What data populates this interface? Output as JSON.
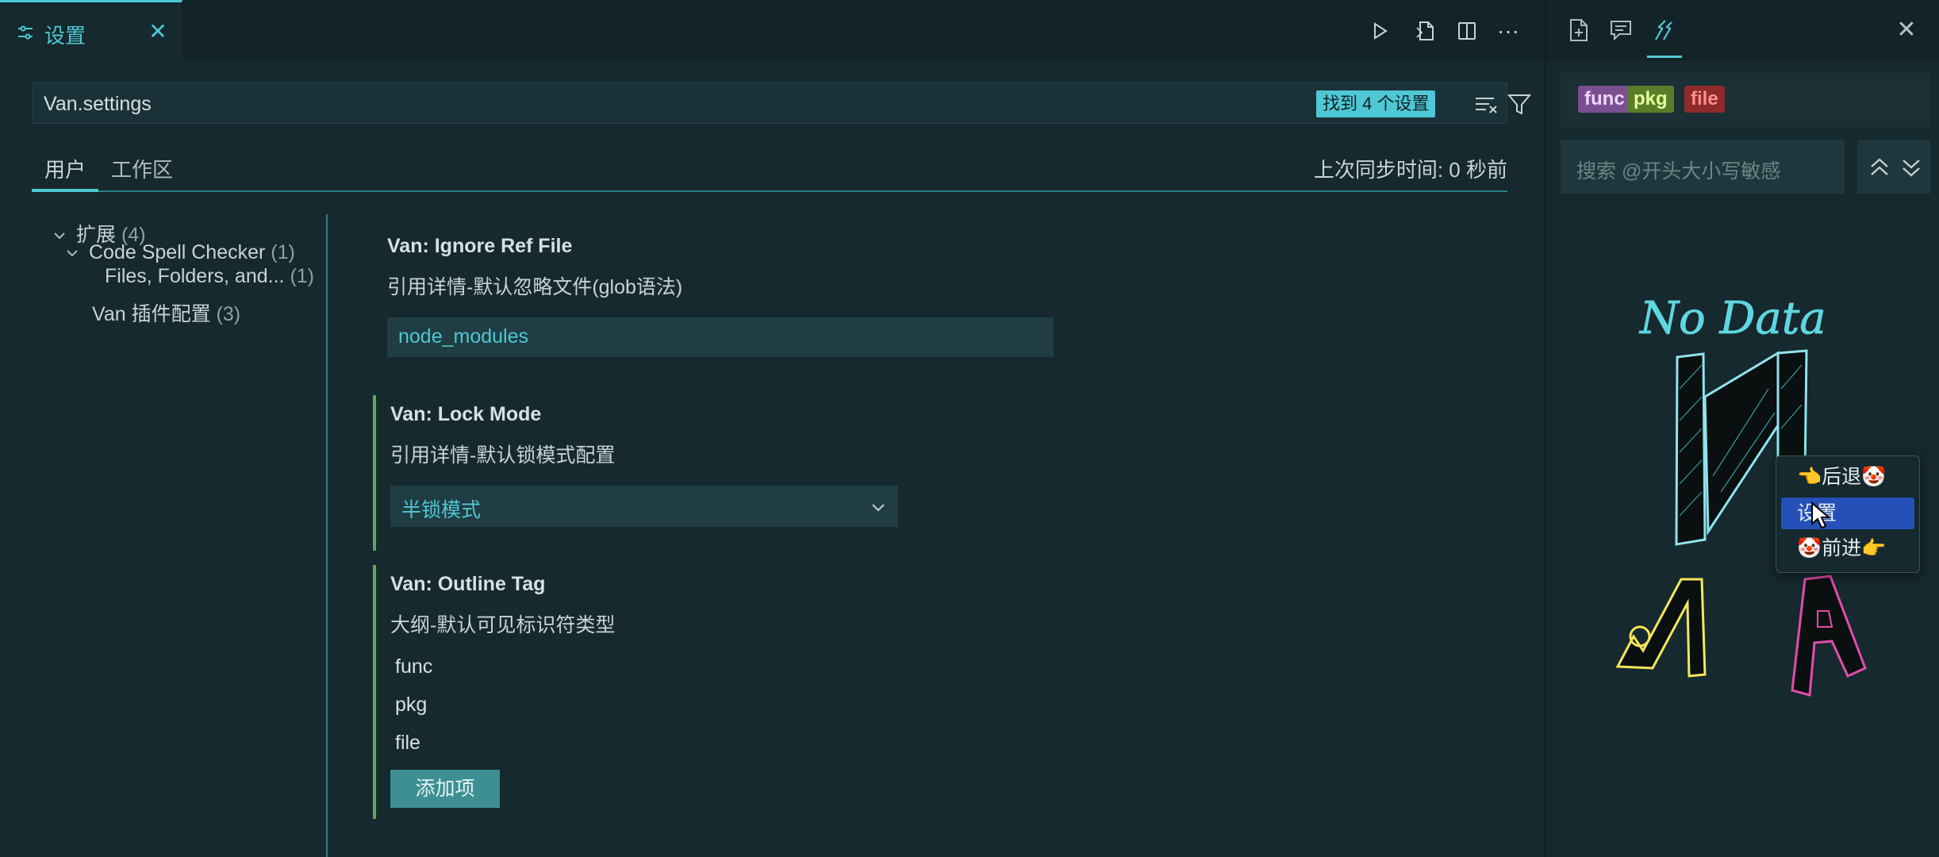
{
  "editor": {
    "tab": {
      "title": "设置",
      "close": "✕",
      "icon": "settings-sliders-icon"
    },
    "toolbar": {
      "icons": [
        "run-icon",
        "open-json-icon",
        "split-editor-icon",
        "more-actions-icon"
      ],
      "more_label": "···"
    },
    "search": {
      "value": "Van.settings",
      "result_badge": "找到 4 个设置",
      "icons": [
        "clear-filter-icon",
        "filter-icon"
      ]
    },
    "scope_tabs": {
      "user": "用户",
      "workspace": "工作区",
      "sync_status": "上次同步时间: 0 秒前"
    },
    "toc": [
      {
        "label": "扩展",
        "count": "(4)",
        "expanded": true
      },
      {
        "label": "Code Spell Checker",
        "count": "(1)",
        "expanded": true
      },
      {
        "label": "Files, Folders, and...",
        "count": "(1)"
      },
      {
        "label": "Van 插件配置",
        "count": "(3)"
      }
    ],
    "settings": [
      {
        "title": "Van: Ignore Ref File",
        "description": "引用详情-默认忽略文件(glob语法)",
        "value": "node_modules"
      },
      {
        "title": "Van: Lock Mode",
        "description": "引用详情-默认锁模式配置",
        "value": "半锁模式"
      },
      {
        "title": "Van: Outline Tag",
        "description": "大纲-默认可见标识符类型",
        "items": [
          "func",
          "pkg",
          "file"
        ],
        "add_button": "添加项"
      }
    ]
  },
  "panel": {
    "header_icons": [
      "new-file-icon",
      "comment-icon",
      "references-icon"
    ],
    "close": "✕",
    "tags": [
      "func",
      "pkg",
      "file"
    ],
    "search_placeholder": "搜索 @开头大小写敏感",
    "nav_icons": [
      "chevron-up-double-icon",
      "chevron-down-double-icon"
    ],
    "empty_art_text": "No Data",
    "context_menu": [
      "👈后退🤡",
      "设置",
      "🤡前进👉"
    ]
  },
  "colors": {
    "accent": "#4fc7d4",
    "background": "#15292e",
    "modified_bar": "#5aa95c",
    "menu_highlight": "#2450b8"
  }
}
